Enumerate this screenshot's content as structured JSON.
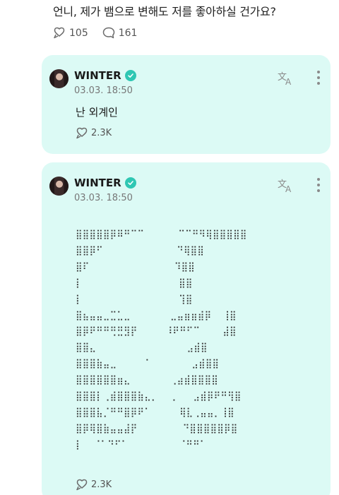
{
  "question": {
    "text": "언니, 제가 뱀으로 변해도 저를 좋아하실 건가요?",
    "likes": "105",
    "comments": "161"
  },
  "replies": [
    {
      "author": "WINTER",
      "date": "03.03. 18:50",
      "text": "난 외계인",
      "likes": "2.3K"
    },
    {
      "author": "WINTER",
      "date": "03.03. 18:50",
      "art": "⣿⣿⣿⣿⣿⡿⠿⠛⠉⠉      ⠉⠉⠛⠻⢿⣿⣿⣿⣿⣿\n⣿⣿⡿⠋             ⠙⢿⣿⣿\n⣿⠏               ⠹⣿⣿\n⡇                 ⣿⣿\n⡇                 ⢹⣿\n⣿⣦⣤⣤⣀⣉⣁⣀       ⣀⣤⣶⣶⣾⡿  ⢸⣿\n⣿⡿⠟⠛⠛⢛⣛⣻⡟     ⠸⠟⠛⠋⠉    ⣼⣿\n⣿⣿⣄                ⣠⣾⣿\n⣿⣿⣿⣷⣤⣀     ⠁       ⣠⣾⣿⣿\n⣿⣿⣿⣿⣿⣿⣶⣄       ⢀⣴⣾⣿⣿⣿⣿\n⣿⣿⣿⡇⢀⣾⣿⣿⣿⣷⣄⡀  ⢀   ⣠⣾⡿⠟⠛⢻⣿\n⣿⣿⣿⣧⡈⠛⠛⣿⡿⠟⠁     ⢿⣇⢀⣤⣤⡀⢸⣿\n⣿⡿⢿⣿⣷⣤⣤⣼⡟        ⠙⣿⣿⣿⣿⣿⡿⣿\n⡇  ⠈⠁⠙⠋⠁         ⠈⠛⠛⠁  ",
      "likes": "2.3K"
    }
  ]
}
